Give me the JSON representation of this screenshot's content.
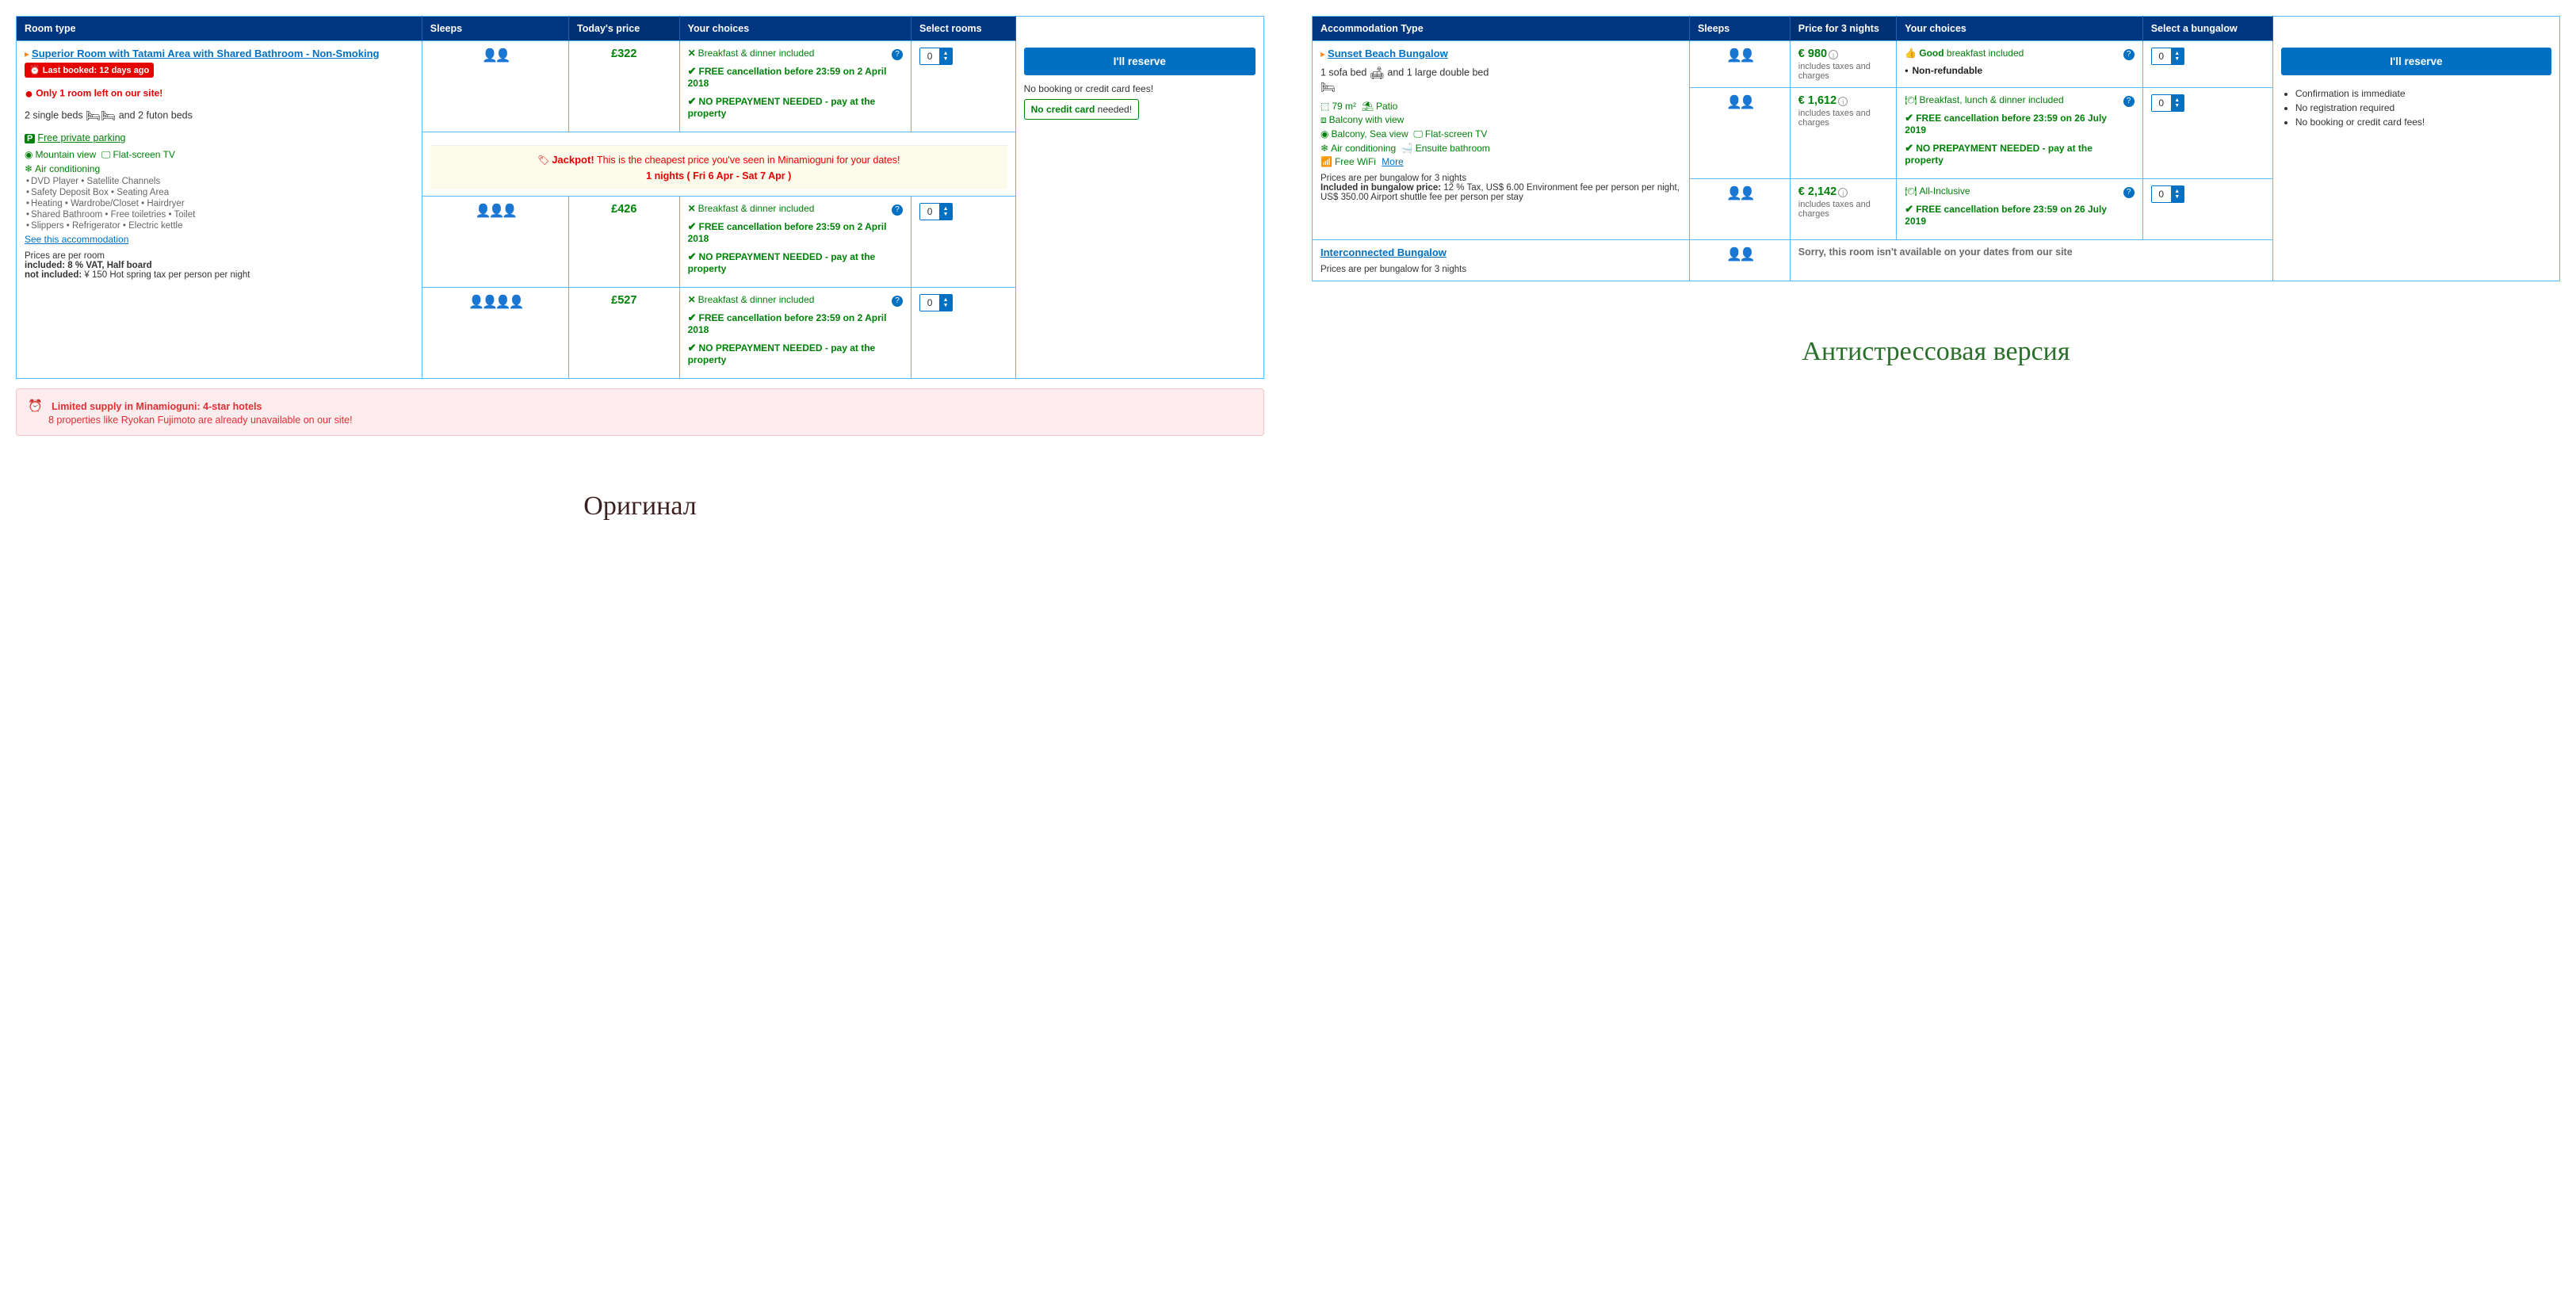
{
  "left": {
    "caption": "Оригинал",
    "headers": {
      "room_type": "Room type",
      "sleeps": "Sleeps",
      "price": "Today's price",
      "choices": "Your choices",
      "select": "Select rooms"
    },
    "room": {
      "title": "Superior Room with Tatami Area with Shared Bathroom - Non-Smoking",
      "last_booked": "Last booked: 12 days ago",
      "only_left": "Only 1 room left on our site!",
      "beds_a": "2 single beds",
      "beds_b": "and 2 futon beds",
      "parking": "Free private parking",
      "amen1a": "Mountain view",
      "amen1b": "Flat-screen TV",
      "amen2": "Air conditioning",
      "amen_row1": "DVD Player • Satellite Channels",
      "amen_row2": "Safety Deposit Box • Seating Area",
      "amen_row3": "Heating • Wardrobe/Closet • Hairdryer",
      "amen_row4": "Shared Bathroom • Free toiletries • Toilet",
      "amen_row5": "Slippers • Refrigerator • Electric kettle",
      "see_acc": "See this accommodation",
      "price_per": "Prices are per room",
      "included": "included: 8 % VAT, Half board",
      "not_included": "not included: ¥ 150 Hot spring tax per person per night"
    },
    "jackpot": {
      "title": "Jackpot!",
      "text": "This is the cheapest price you've seen in Minamioguni for your dates!",
      "nights": "1 nights ( Fri 6 Apr - Sat 7 Apr )"
    },
    "rates": [
      {
        "sleeps": 2,
        "price": "£322"
      },
      {
        "sleeps": 3,
        "price": "£426"
      },
      {
        "sleeps": 4,
        "price": "£527"
      }
    ],
    "choice_block": {
      "breakfast": "Breakfast & dinner included",
      "cancel_a": "FREE cancellation",
      "cancel_b": "before 23:59 on 2 April 2018",
      "noprepay": "NO PREPAYMENT NEEDED - pay at the property"
    },
    "reserve_btn": "I'll reserve",
    "reserve_note": "No booking or credit card fees!",
    "no_card_a": "No credit card",
    "no_card_b": "needed!",
    "limited": {
      "l1": "Limited supply in Minamioguni: 4-star hotels",
      "l2": "8 properties like Ryokan Fujimoto are already unavailable on our site!"
    }
  },
  "right": {
    "caption": "Антистрессовая версия",
    "headers": {
      "room_type": "Accommodation Type",
      "sleeps": "Sleeps",
      "price": "Price for 3 nights",
      "choices": "Your choices",
      "select": "Select a bungalow"
    },
    "room": {
      "title": "Sunset Beach Bungalow",
      "beds_a": "1 sofa bed",
      "beds_b": "and 1 large double bed",
      "area": "79 m²",
      "patio": "Patio",
      "balcony_view": "Balcony with view",
      "balcony_sea": "Balcony, Sea view",
      "flat_tv": "Flat-screen TV",
      "ac": "Air conditioning",
      "ensuite": "Ensuite bathroom",
      "wifi": "Free WiFi",
      "more": "More",
      "price_per": "Prices are per bungalow for 3 nights",
      "included_label": "Included in bungalow price:",
      "included_text": "12 % Tax, US$ 6.00 Environment fee per person per night, US$ 350.00 Airport shuttle fee per person per stay"
    },
    "rates": [
      {
        "sleeps": 2,
        "price": "€ 980",
        "sub": "includes taxes and charges",
        "choices": {
          "good": "Good",
          "good_rest": "breakfast included",
          "nonref": "Non-refundable"
        }
      },
      {
        "sleeps": 2,
        "price": "€ 1,612",
        "sub": "includes taxes and charges",
        "choices": {
          "meal": "Breakfast, lunch & dinner included",
          "cancel_a": "FREE cancellation",
          "cancel_b": "before 23:59 on 26 July 2019",
          "noprepay": "NO PREPAYMENT NEEDED - pay at the property"
        }
      },
      {
        "sleeps": 2,
        "price": "€ 2,142",
        "sub": "includes taxes and charges",
        "choices": {
          "meal": "All-Inclusive",
          "cancel_a": "FREE cancellation",
          "cancel_b": "before 23:59 on 26 July 2019"
        }
      }
    ],
    "room2": {
      "title": "Interconnected Bungalow",
      "unavail": "Sorry, this room isn't available on your dates from our site",
      "price_per": "Prices are per bungalow for 3 nights"
    },
    "reserve_btn": "I'll reserve",
    "reserve_notes": {
      "n1": "Confirmation is immediate",
      "n2": "No registration required",
      "n3": "No booking or credit card fees!"
    }
  }
}
